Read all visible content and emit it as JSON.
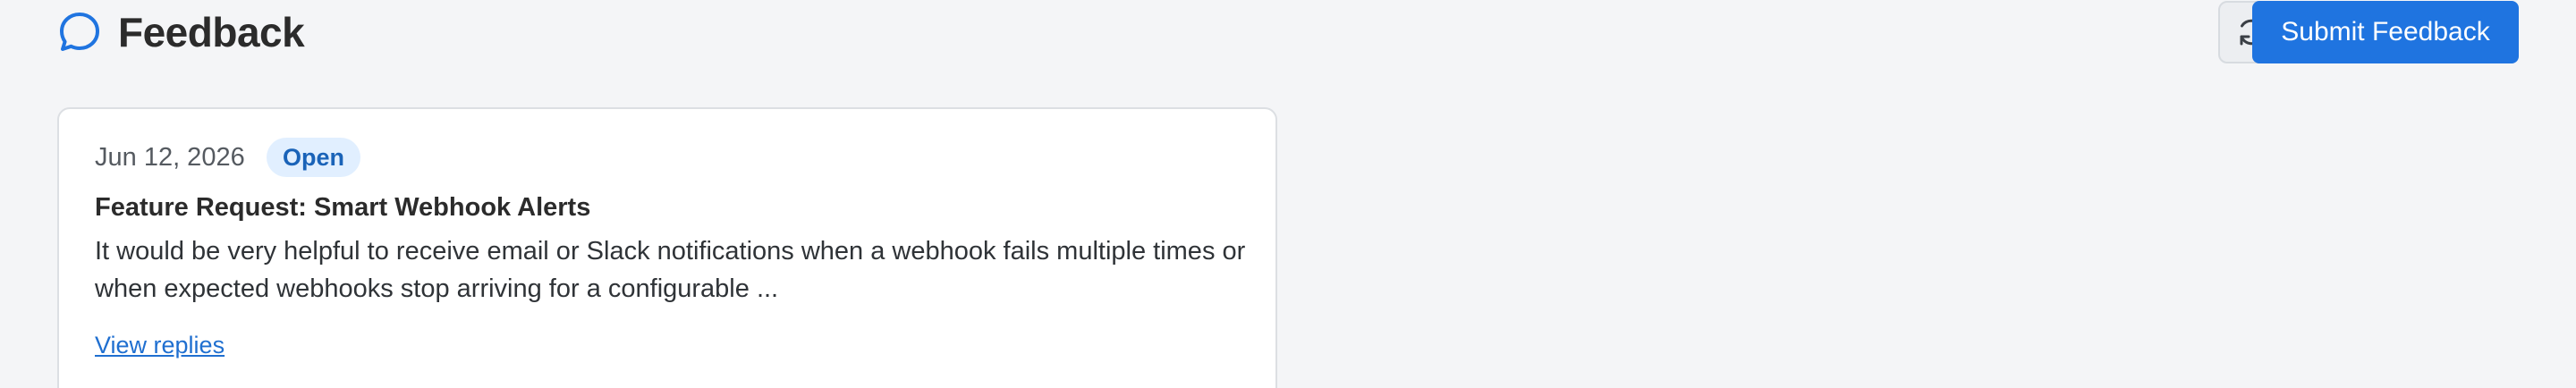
{
  "header": {
    "title": "Feedback",
    "title_icon": "chat-bubble-icon",
    "refresh_icon": "refresh-icon",
    "submit_label": "Submit Feedback"
  },
  "colors": {
    "accent": "#1f74e0",
    "badge_bg": "#e1efff",
    "badge_text": "#1a63b8",
    "link": "#1f6fd0",
    "background": "#f4f5f7"
  },
  "feedback_items": [
    {
      "date": "Jun 12, 2026",
      "status": "Open",
      "title": "Feature Request: Smart Webhook Alerts",
      "body": "It would be very helpful to receive email or Slack notifications when a webhook fails multiple times or when expected webhooks stop arriving for a configurable ...",
      "link_label": "View replies"
    }
  ]
}
